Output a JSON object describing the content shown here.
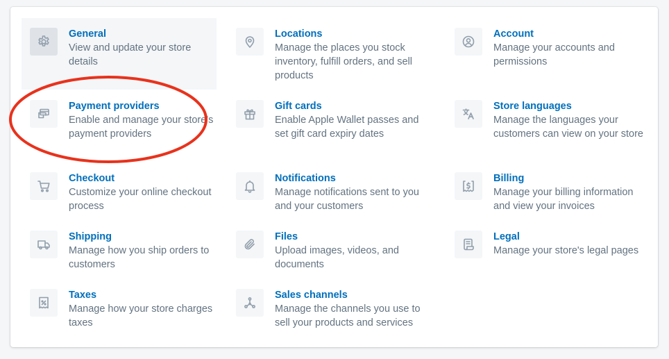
{
  "settings": {
    "items": [
      {
        "title": "General",
        "desc": "View and update your store details",
        "icon": "gear-icon"
      },
      {
        "title": "Locations",
        "desc": "Manage the places you stock inventory, fulfill orders, and sell products",
        "icon": "location-pin-icon"
      },
      {
        "title": "Account",
        "desc": "Manage your accounts and permissions",
        "icon": "account-icon"
      },
      {
        "title": "Payment providers",
        "desc": "Enable and manage your store's payment providers",
        "icon": "payment-cards-icon"
      },
      {
        "title": "Gift cards",
        "desc": "Enable Apple Wallet passes and set gift card expiry dates",
        "icon": "gift-icon"
      },
      {
        "title": "Store languages",
        "desc": "Manage the languages your customers can view on your store",
        "icon": "translate-icon"
      },
      {
        "title": "Checkout",
        "desc": "Customize your online checkout process",
        "icon": "cart-icon"
      },
      {
        "title": "Notifications",
        "desc": "Manage notifications sent to you and your customers",
        "icon": "bell-icon"
      },
      {
        "title": "Billing",
        "desc": "Manage your billing information and view your invoices",
        "icon": "billing-icon"
      },
      {
        "title": "Shipping",
        "desc": "Manage how you ship orders to customers",
        "icon": "truck-icon"
      },
      {
        "title": "Files",
        "desc": "Upload images, videos, and documents",
        "icon": "paperclip-icon"
      },
      {
        "title": "Legal",
        "desc": "Manage your store's legal pages",
        "icon": "legal-scroll-icon"
      },
      {
        "title": "Taxes",
        "desc": "Manage how your store charges taxes",
        "icon": "tax-receipt-icon"
      },
      {
        "title": "Sales channels",
        "desc": "Manage the channels you use to sell your products and services",
        "icon": "sales-channels-icon"
      }
    ]
  },
  "colors": {
    "link": "#006fbb",
    "text_subdued": "#637381",
    "icon": "#919eab",
    "annotation": "#e8321c"
  }
}
